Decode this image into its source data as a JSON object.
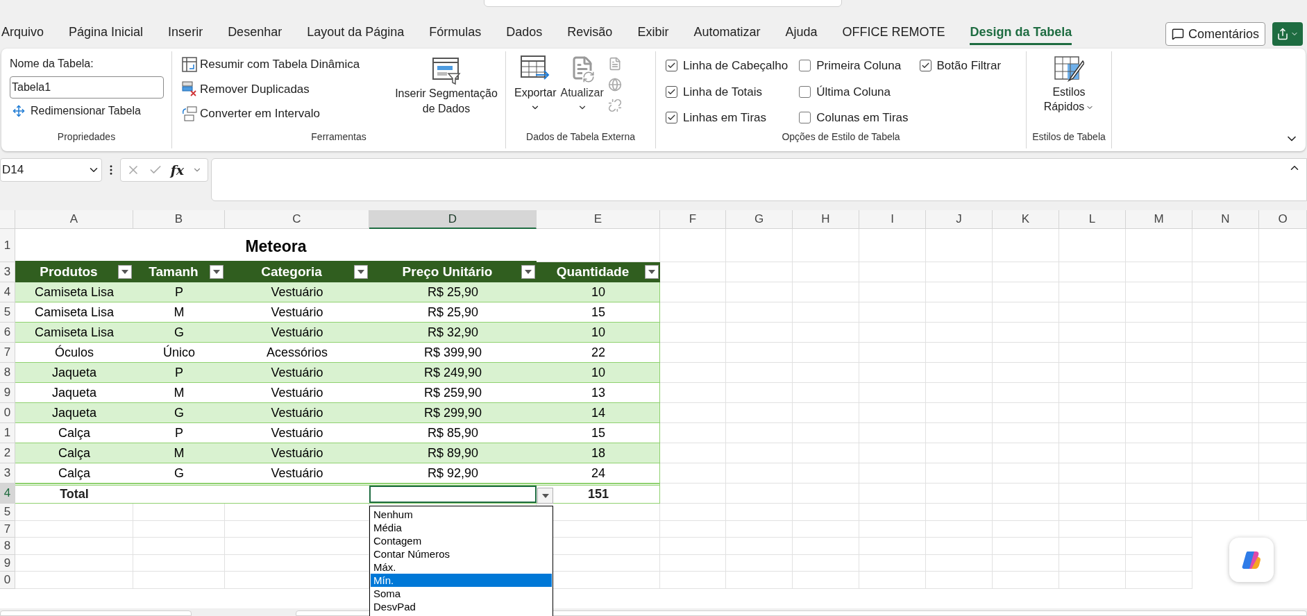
{
  "menu_tabs": [
    {
      "label": "Arquivo",
      "selected": false
    },
    {
      "label": "Página Inicial",
      "selected": false
    },
    {
      "label": "Inserir",
      "selected": false
    },
    {
      "label": "Desenhar",
      "selected": false
    },
    {
      "label": "Layout da Página",
      "selected": false
    },
    {
      "label": "Fórmulas",
      "selected": false
    },
    {
      "label": "Dados",
      "selected": false
    },
    {
      "label": "Revisão",
      "selected": false
    },
    {
      "label": "Exibir",
      "selected": false
    },
    {
      "label": "Automatizar",
      "selected": false
    },
    {
      "label": "Ajuda",
      "selected": false
    },
    {
      "label": "OFFICE REMOTE",
      "selected": false
    },
    {
      "label": "Design da Tabela",
      "selected": true
    }
  ],
  "comments_button": {
    "label": "Comentários"
  },
  "ribbon": {
    "properties": {
      "title": "Nome da Tabela:",
      "table_name": "Tabela1",
      "resize_button": "Redimensionar Tabela",
      "group_label": "Propriedades"
    },
    "tools": {
      "items": [
        {
          "kind": "pivot",
          "label": "Resumir com Tabela Dinâmica"
        },
        {
          "kind": "duplicates",
          "label": "Remover Duplicadas"
        },
        {
          "kind": "convert",
          "label": "Converter em Intervalo"
        }
      ],
      "slicer_button": "Inserir Segmentação de Dados",
      "group_label": "Ferramentas"
    },
    "external_data": {
      "export_button": "Exportar",
      "refresh_button": "Atualizar",
      "group_label": "Dados de Tabela Externa"
    },
    "style_options": {
      "checkboxes": [
        {
          "label": "Linha de Cabeçalho",
          "checked": true
        },
        {
          "label": "Linha de Totais",
          "checked": true
        },
        {
          "label": "Linhas em Tiras",
          "checked": true
        },
        {
          "label": "Primeira Coluna",
          "checked": false
        },
        {
          "label": "Última Coluna",
          "checked": false
        },
        {
          "label": "Colunas em Tiras",
          "checked": false
        },
        {
          "label": "Botão Filtrar",
          "checked": true
        }
      ],
      "group_label": "Opções de Estilo de Tabela"
    },
    "table_styles": {
      "button": "Estilos Rápidos",
      "group_label": "Estilos de Tabela"
    }
  },
  "formula_bar": {
    "name_box": "D14",
    "function_label": "fx"
  },
  "columns": [
    {
      "label": "A",
      "selected": false
    },
    {
      "label": "B",
      "selected": false
    },
    {
      "label": "C",
      "selected": false
    },
    {
      "label": "D",
      "selected": true
    },
    {
      "label": "E",
      "selected": false
    },
    {
      "label": "F",
      "selected": false
    },
    {
      "label": "G",
      "selected": false
    },
    {
      "label": "H",
      "selected": false
    },
    {
      "label": "I",
      "selected": false
    },
    {
      "label": "J",
      "selected": false
    },
    {
      "label": "K",
      "selected": false
    },
    {
      "label": "L",
      "selected": false
    },
    {
      "label": "M",
      "selected": false
    },
    {
      "label": "N",
      "selected": false
    },
    {
      "label": "O",
      "selected": false
    }
  ],
  "rows": [
    {
      "label": "1",
      "selected": false
    },
    {
      "label": "3",
      "selected": false
    },
    {
      "label": "4",
      "selected": false
    },
    {
      "label": "5",
      "selected": false
    },
    {
      "label": "6",
      "selected": false
    },
    {
      "label": "7",
      "selected": false
    },
    {
      "label": "8",
      "selected": false
    },
    {
      "label": "9",
      "selected": false
    },
    {
      "label": "0",
      "selected": false
    },
    {
      "label": "1",
      "selected": false
    },
    {
      "label": "2",
      "selected": false
    },
    {
      "label": "3",
      "selected": false
    },
    {
      "label": "4",
      "selected": true
    },
    {
      "label": "5",
      "selected": false
    },
    {
      "label": "7",
      "selected": false
    },
    {
      "label": "8",
      "selected": false
    },
    {
      "label": "9",
      "selected": false
    },
    {
      "label": "0",
      "selected": false
    }
  ],
  "table": {
    "title": "Meteora",
    "headers": [
      "Produtos",
      "Tamanh",
      "Categoria",
      "Preço Unitário",
      "Quantidade"
    ],
    "body": [
      {
        "banded": true,
        "cells": [
          "Camiseta Lisa",
          "P",
          "Vestuário",
          "R$ 25,90",
          "10"
        ]
      },
      {
        "banded": false,
        "cells": [
          "Camiseta Lisa",
          "M",
          "Vestuário",
          "R$ 25,90",
          "15"
        ]
      },
      {
        "banded": true,
        "cells": [
          "Camiseta Lisa",
          "G",
          "Vestuário",
          "R$ 32,90",
          "10"
        ]
      },
      {
        "banded": false,
        "cells": [
          "Óculos",
          "Único",
          "Acessórios",
          "R$ 399,90",
          "22"
        ]
      },
      {
        "banded": true,
        "cells": [
          "Jaqueta",
          "P",
          "Vestuário",
          "R$ 249,90",
          "10"
        ]
      },
      {
        "banded": false,
        "cells": [
          "Jaqueta",
          "M",
          "Vestuário",
          "R$ 259,90",
          "13"
        ]
      },
      {
        "banded": true,
        "cells": [
          "Jaqueta",
          "G",
          "Vestuário",
          "R$ 299,90",
          "14"
        ]
      },
      {
        "banded": false,
        "cells": [
          "Calça",
          "P",
          "Vestuário",
          "R$ 85,90",
          "15"
        ]
      },
      {
        "banded": true,
        "cells": [
          "Calça",
          "M",
          "Vestuário",
          "R$ 89,90",
          "18"
        ]
      },
      {
        "banded": false,
        "cells": [
          "Calça",
          "G",
          "Vestuário",
          "R$ 92,90",
          "24"
        ]
      }
    ],
    "total": {
      "label": "Total",
      "value": "151"
    }
  },
  "totals_menu": {
    "options": [
      {
        "label": "Nenhum",
        "selected": false
      },
      {
        "label": "Média",
        "selected": false
      },
      {
        "label": "Contagem",
        "selected": false
      },
      {
        "label": "Contar Números",
        "selected": false
      },
      {
        "label": "Máx.",
        "selected": false
      },
      {
        "label": "Mín.",
        "selected": true
      },
      {
        "label": "Soma",
        "selected": false
      },
      {
        "label": "DesvPad",
        "selected": false
      }
    ]
  }
}
